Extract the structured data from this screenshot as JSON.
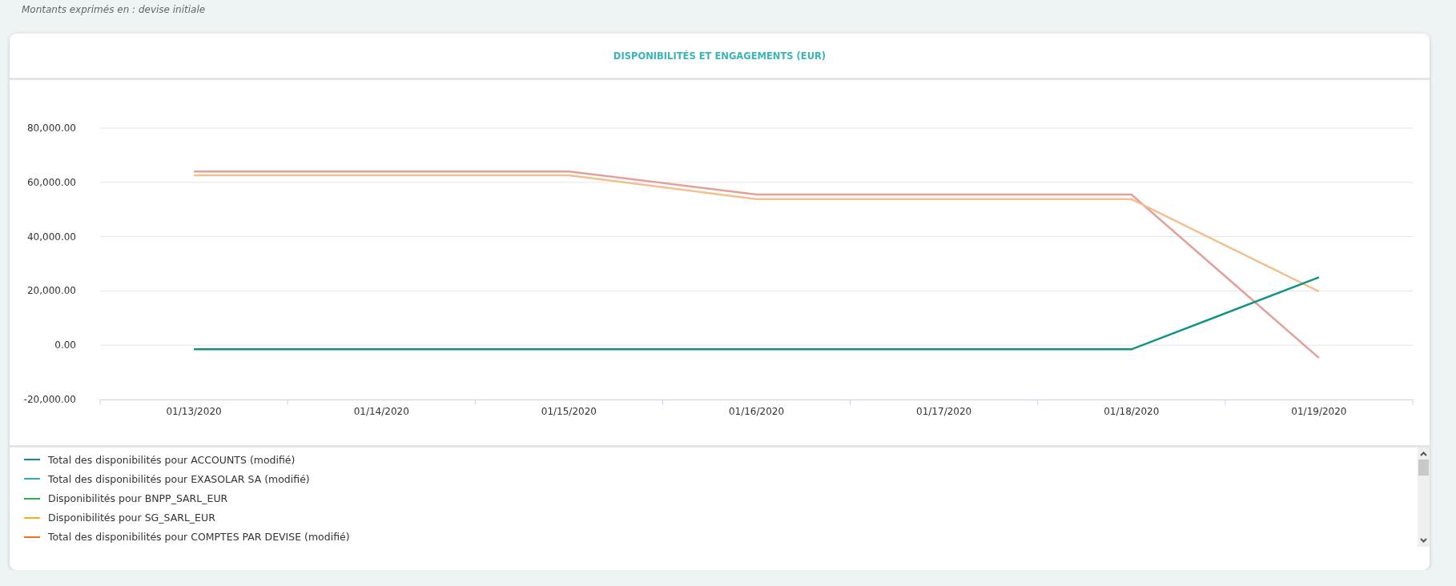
{
  "note": "Montants exprimés en : devise initiale",
  "card": {
    "title": "DISPONIBILITÉS ET ENGAGEMENTS (EUR)",
    "chart_data": {
      "type": "line",
      "categories": [
        "01/13/2020",
        "01/14/2020",
        "01/15/2020",
        "01/16/2020",
        "01/17/2020",
        "01/18/2020",
        "01/19/2020"
      ],
      "ylim": [
        -20000,
        80000
      ],
      "yticks": [
        {
          "value": -20000,
          "label": "-20,000.00"
        },
        {
          "value": 0,
          "label": "0.00"
        },
        {
          "value": 20000,
          "label": "20,000.00"
        },
        {
          "value": 40000,
          "label": "40,000.00"
        },
        {
          "value": 60000,
          "label": "60,000.00"
        },
        {
          "value": 80000,
          "label": "80,000.00"
        }
      ],
      "grid": true,
      "series": [
        {
          "color": "#e3a09a",
          "values": [
            64000,
            64000,
            64000,
            55500,
            55500,
            55500,
            -4700
          ]
        },
        {
          "color": "#f2bf8e",
          "values": [
            62600,
            62600,
            62600,
            53800,
            53800,
            53800,
            19800
          ]
        },
        {
          "color": "#119283",
          "values": [
            -1500,
            -1500,
            -1500,
            -1500,
            -1500,
            -1500,
            25000
          ]
        }
      ]
    },
    "legend": [
      {
        "label": "Total des disponibilités pour ACCOUNTS (modifié)",
        "color": "#16878a"
      },
      {
        "label": "Total des disponibilités pour EXASOLAR SA (modifié)",
        "color": "#26b3b0"
      },
      {
        "label": "Disponibilités pour BNPP_SARL_EUR",
        "color": "#3aa64c"
      },
      {
        "label": "Disponibilités pour SG_SARL_EUR",
        "color": "#f0b21b"
      },
      {
        "label": "Total des disponibilités pour COMPTES PAR DEVISE (modifié)",
        "color": "#f37021"
      }
    ]
  }
}
